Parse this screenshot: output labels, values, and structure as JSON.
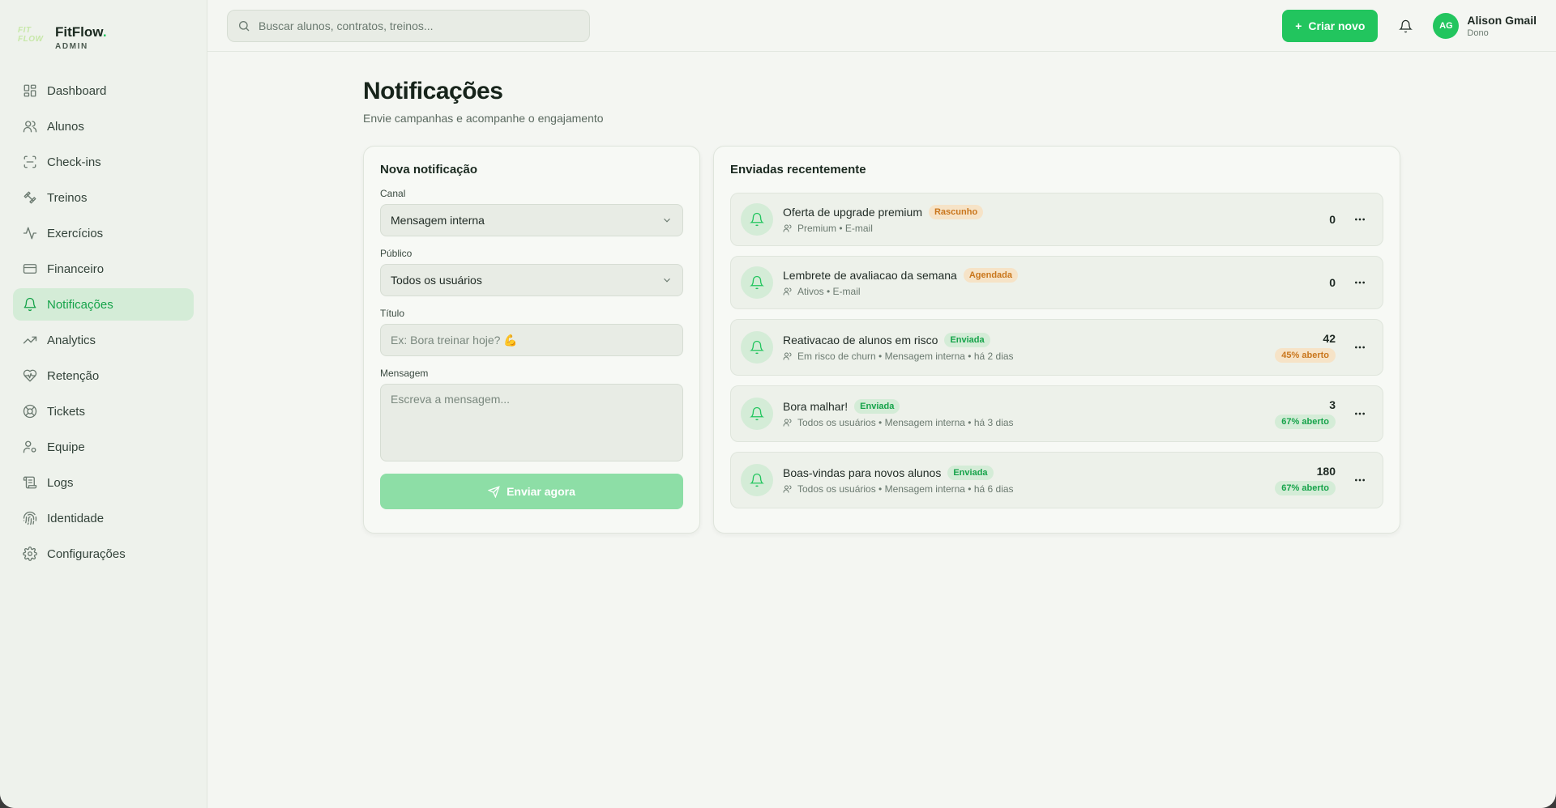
{
  "brand": {
    "logo_text": "FIT FLOW",
    "name": "FitFlow",
    "dot": ".",
    "subtitle": "ADMIN"
  },
  "sidebar": {
    "items": [
      {
        "label": "Dashboard",
        "icon": "grid-icon"
      },
      {
        "label": "Alunos",
        "icon": "users-icon"
      },
      {
        "label": "Check-ins",
        "icon": "scan-icon"
      },
      {
        "label": "Treinos",
        "icon": "dumbbell-icon"
      },
      {
        "label": "Exercícios",
        "icon": "activity-icon"
      },
      {
        "label": "Financeiro",
        "icon": "credit-card-icon"
      },
      {
        "label": "Notificações",
        "icon": "bell-icon",
        "active": true
      },
      {
        "label": "Analytics",
        "icon": "trending-up-icon"
      },
      {
        "label": "Retenção",
        "icon": "heart-pulse-icon"
      },
      {
        "label": "Tickets",
        "icon": "lifebuoy-icon"
      },
      {
        "label": "Equipe",
        "icon": "user-cog-icon"
      },
      {
        "label": "Logs",
        "icon": "scroll-icon"
      },
      {
        "label": "Identidade",
        "icon": "fingerprint-icon"
      },
      {
        "label": "Configurações",
        "icon": "gear-icon"
      }
    ]
  },
  "topbar": {
    "search_placeholder": "Buscar alunos, contratos, treinos...",
    "create_label": "Criar novo",
    "user": {
      "initials": "AG",
      "name": "Alison Gmail",
      "role": "Dono"
    }
  },
  "page": {
    "title": "Notificações",
    "subtitle": "Envie campanhas e acompanhe o engajamento"
  },
  "form": {
    "title": "Nova notificação",
    "channel_label": "Canal",
    "channel_value": "Mensagem interna",
    "audience_label": "Público",
    "audience_value": "Todos os usuários",
    "title_label": "Título",
    "title_placeholder": "Ex: Bora treinar hoje? 💪",
    "message_label": "Mensagem",
    "message_placeholder": "Escreva a mensagem...",
    "send_label": "Enviar agora"
  },
  "recent": {
    "title": "Enviadas recentemente",
    "items": [
      {
        "title": "Oferta de upgrade premium",
        "status": "Rascunho",
        "meta": "Premium • E-mail",
        "count": "0",
        "open": ""
      },
      {
        "title": "Lembrete de avaliacao da semana",
        "status": "Agendada",
        "meta": "Ativos • E-mail",
        "count": "0",
        "open": ""
      },
      {
        "title": "Reativacao de alunos em risco",
        "status": "Enviada",
        "meta": "Em risco de churn • Mensagem interna • há 2 dias",
        "count": "42",
        "open": "45% aberto"
      },
      {
        "title": "Bora malhar!",
        "status": "Enviada",
        "meta": "Todos os usuários • Mensagem interna • há 3 dias",
        "count": "3",
        "open": "67% aberto"
      },
      {
        "title": "Boas-vindas para novos alunos",
        "status": "Enviada",
        "meta": "Todos os usuários • Mensagem interna • há 6 dias",
        "count": "180",
        "open": "67% aberto"
      }
    ]
  },
  "colors": {
    "accent": "#22c55e",
    "active_bg": "#d4ecd7",
    "warning": "#c9761c"
  }
}
